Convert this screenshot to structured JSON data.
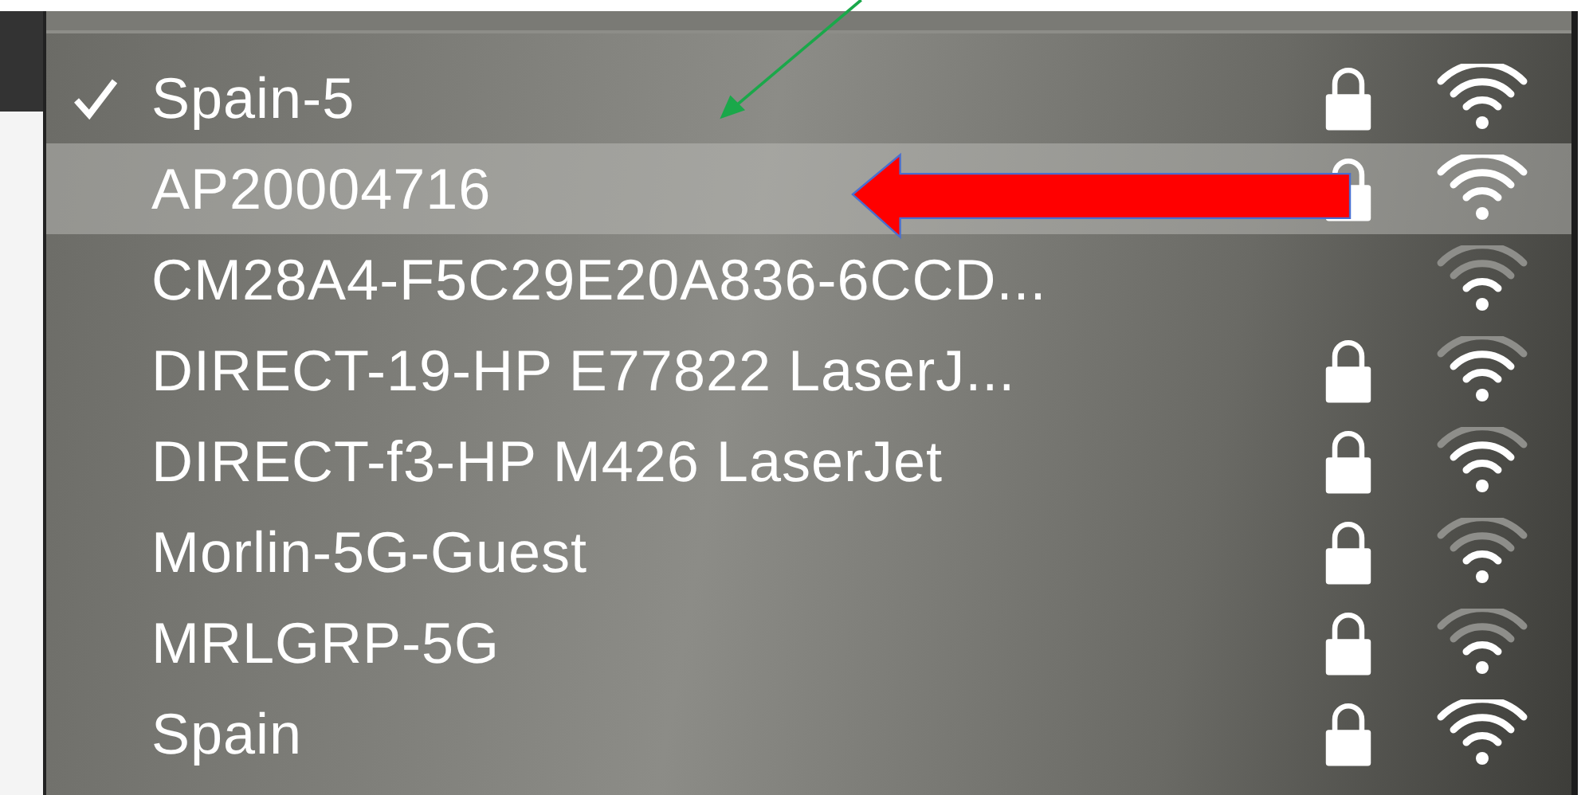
{
  "networks": [
    {
      "name": "Spain-5",
      "connected": true,
      "selected": false,
      "locked": true,
      "kind": "strong"
    },
    {
      "name": "AP20004716",
      "connected": false,
      "selected": true,
      "locked": true,
      "kind": "strong"
    },
    {
      "name": "CM28A4-F5C29E20A836-6CCD...",
      "connected": false,
      "selected": false,
      "locked": false,
      "kind": "weak"
    },
    {
      "name": "DIRECT-19-HP E77822 LaserJ...",
      "connected": false,
      "selected": false,
      "locked": true,
      "kind": "medium"
    },
    {
      "name": "DIRECT-f3-HP M426 LaserJet",
      "connected": false,
      "selected": false,
      "locked": true,
      "kind": "medium"
    },
    {
      "name": "Morlin-5G-Guest",
      "connected": false,
      "selected": false,
      "locked": true,
      "kind": "weak"
    },
    {
      "name": "MRLGRP-5G",
      "connected": false,
      "selected": false,
      "locked": true,
      "kind": "weak"
    },
    {
      "name": "Spain",
      "connected": false,
      "selected": false,
      "locked": true,
      "kind": "strong"
    }
  ]
}
